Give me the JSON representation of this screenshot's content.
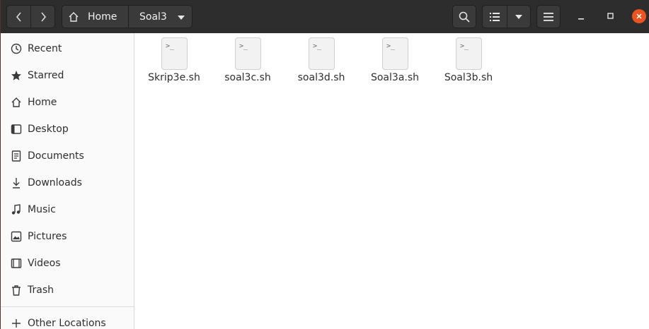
{
  "header": {
    "back_icon": "chevron-left-icon",
    "forward_icon": "chevron-right-icon",
    "breadcrumbs": [
      {
        "label": "Home",
        "icon": "home-icon"
      },
      {
        "label": "Soal3"
      }
    ],
    "search_icon": "search-icon",
    "view_icon": "list-view-icon",
    "view_options_icon": "chevron-down-icon",
    "menu_icon": "hamburger-menu-icon",
    "close_color": "#e95420"
  },
  "sidebar": {
    "items": [
      {
        "label": "Recent",
        "icon": "clock-icon"
      },
      {
        "label": "Starred",
        "icon": "star-icon"
      },
      {
        "label": "Home",
        "icon": "home-icon"
      },
      {
        "label": "Desktop",
        "icon": "desktop-icon"
      },
      {
        "label": "Documents",
        "icon": "document-icon"
      },
      {
        "label": "Downloads",
        "icon": "download-icon"
      },
      {
        "label": "Music",
        "icon": "music-icon"
      },
      {
        "label": "Pictures",
        "icon": "picture-icon"
      },
      {
        "label": "Videos",
        "icon": "video-icon"
      },
      {
        "label": "Trash",
        "icon": "trash-icon"
      }
    ],
    "other_locations": {
      "label": "Other Locations",
      "icon": "plus-icon"
    }
  },
  "files": [
    {
      "name": "Skrip3e.sh",
      "glyph": ">_"
    },
    {
      "name": "soal3c.sh",
      "glyph": ">_"
    },
    {
      "name": "soal3d.sh",
      "glyph": ">_"
    },
    {
      "name": "Soal3a.sh",
      "glyph": ">_"
    },
    {
      "name": "Soal3b.sh",
      "glyph": ">_"
    }
  ]
}
